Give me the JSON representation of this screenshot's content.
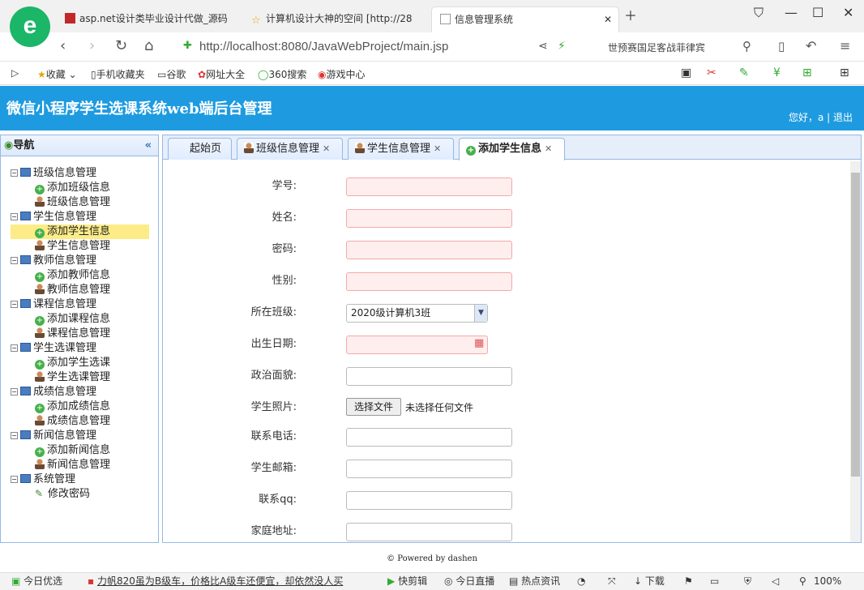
{
  "browser": {
    "tabs": [
      {
        "title": "asp.net设计类毕业设计代做_源码"
      },
      {
        "title": "计算机设计大神的空间 [http://28"
      },
      {
        "title": "信息管理系统"
      }
    ],
    "url": "http://localhost:8080/JavaWebProject/main.jsp",
    "search_hint": "世预赛国足客战菲律宾",
    "bookmarks": [
      "收藏",
      "手机收藏夹",
      "谷歌",
      "网址大全",
      "360搜索",
      "游戏中心"
    ],
    "logo_letter": "e"
  },
  "app": {
    "title": "微信小程序学生选课系统web端后台管理",
    "user_greeting": "您好，a",
    "logout": "退出"
  },
  "sidebar": {
    "title": "导航",
    "groups": [
      {
        "label": "班级信息管理",
        "items": [
          {
            "label": "添加班级信息",
            "icon": "add"
          },
          {
            "label": "班级信息管理",
            "icon": "user"
          }
        ]
      },
      {
        "label": "学生信息管理",
        "items": [
          {
            "label": "添加学生信息",
            "icon": "add",
            "selected": true
          },
          {
            "label": "学生信息管理",
            "icon": "user"
          }
        ]
      },
      {
        "label": "教师信息管理",
        "items": [
          {
            "label": "添加教师信息",
            "icon": "add"
          },
          {
            "label": "教师信息管理",
            "icon": "user"
          }
        ]
      },
      {
        "label": "课程信息管理",
        "items": [
          {
            "label": "添加课程信息",
            "icon": "add"
          },
          {
            "label": "课程信息管理",
            "icon": "user"
          }
        ]
      },
      {
        "label": "学生选课管理",
        "items": [
          {
            "label": "添加学生选课",
            "icon": "add"
          },
          {
            "label": "学生选课管理",
            "icon": "user"
          }
        ]
      },
      {
        "label": "成绩信息管理",
        "items": [
          {
            "label": "添加成绩信息",
            "icon": "add"
          },
          {
            "label": "成绩信息管理",
            "icon": "user"
          }
        ]
      },
      {
        "label": "新闻信息管理",
        "items": [
          {
            "label": "添加新闻信息",
            "icon": "add"
          },
          {
            "label": "新闻信息管理",
            "icon": "user"
          }
        ]
      },
      {
        "label": "系统管理",
        "items": [
          {
            "label": "修改密码",
            "icon": "pen"
          }
        ]
      }
    ]
  },
  "page_tabs": [
    {
      "label": "起始页"
    },
    {
      "label": "班级信息管理"
    },
    {
      "label": "学生信息管理"
    },
    {
      "label": "添加学生信息"
    }
  ],
  "form": {
    "student_no": {
      "label": "学号:",
      "value": ""
    },
    "name": {
      "label": "姓名:",
      "value": ""
    },
    "password": {
      "label": "密码:",
      "value": ""
    },
    "gender": {
      "label": "性别:",
      "value": ""
    },
    "class": {
      "label": "所在班级:",
      "value": "2020级计算机3班"
    },
    "birthday": {
      "label": "出生日期:",
      "value": ""
    },
    "politics": {
      "label": "政治面貌:",
      "value": ""
    },
    "photo": {
      "label": "学生照片:",
      "button": "选择文件",
      "status": "未选择任何文件"
    },
    "phone": {
      "label": "联系电话:",
      "value": ""
    },
    "email": {
      "label": "学生邮箱:",
      "value": ""
    },
    "qq": {
      "label": "联系qq:",
      "value": ""
    },
    "address": {
      "label": "家庭地址:",
      "value": ""
    }
  },
  "footer": "© Powered by dashen",
  "statusbar": {
    "left": "今日优选",
    "news": "力帆820虽为B级车，价格比A级车还便宜，却依然没人买",
    "items": [
      "快剪辑",
      "今日直播",
      "热点资讯",
      "下载"
    ],
    "zoom": "100%"
  }
}
